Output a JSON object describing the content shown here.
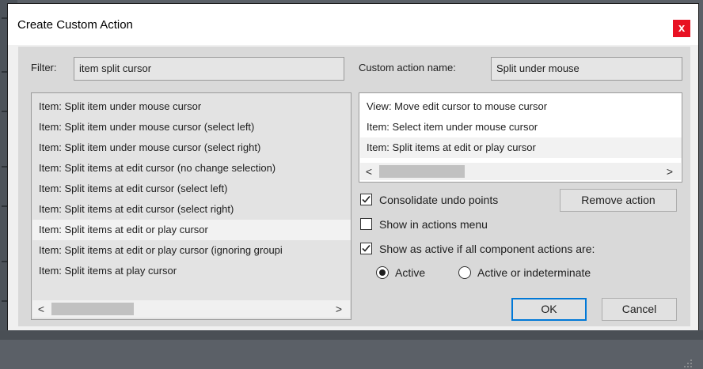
{
  "window": {
    "title": "Create Custom Action",
    "close_glyph": "x"
  },
  "filter": {
    "label": "Filter:",
    "value": "item split cursor"
  },
  "custom_name": {
    "label": "Custom action name:",
    "value": "Split under mouse"
  },
  "left_list": {
    "items": [
      "Item: Split item under mouse cursor",
      "Item: Split item under mouse cursor (select left)",
      "Item: Split item under mouse cursor (select right)",
      "Item: Split items at edit cursor (no change selection)",
      "Item: Split items at edit cursor (select left)",
      "Item: Split items at edit cursor (select right)",
      "Item: Split items at edit or play cursor",
      "Item: Split items at edit or play cursor (ignoring groupi",
      "Item: Split items at play cursor"
    ],
    "selected_index": 6
  },
  "right_list": {
    "items": [
      "View: Move edit cursor to mouse cursor",
      "Item: Select item under mouse cursor",
      "Item: Split items at edit or play cursor"
    ],
    "selected_index": 2
  },
  "scroll": {
    "left_arrow": "<",
    "right_arrow": ">"
  },
  "options": {
    "consolidate": {
      "label": "Consolidate undo points",
      "checked": true
    },
    "show_in_menu": {
      "label": "Show in actions menu",
      "checked": false
    },
    "show_as_active": {
      "label": "Show as active if all component actions are:",
      "checked": true
    },
    "radio_active": {
      "label": "Active",
      "selected": true
    },
    "radio_indeterminate": {
      "label": "Active or indeterminate",
      "selected": false
    }
  },
  "buttons": {
    "remove": "Remove action",
    "ok": "OK",
    "cancel": "Cancel"
  },
  "colors": {
    "close": "#e81123",
    "accent": "#0078d7"
  },
  "icons": [
    "close-icon",
    "check-icon",
    "chevron-left-icon",
    "chevron-right-icon",
    "resize-grip-icon"
  ]
}
